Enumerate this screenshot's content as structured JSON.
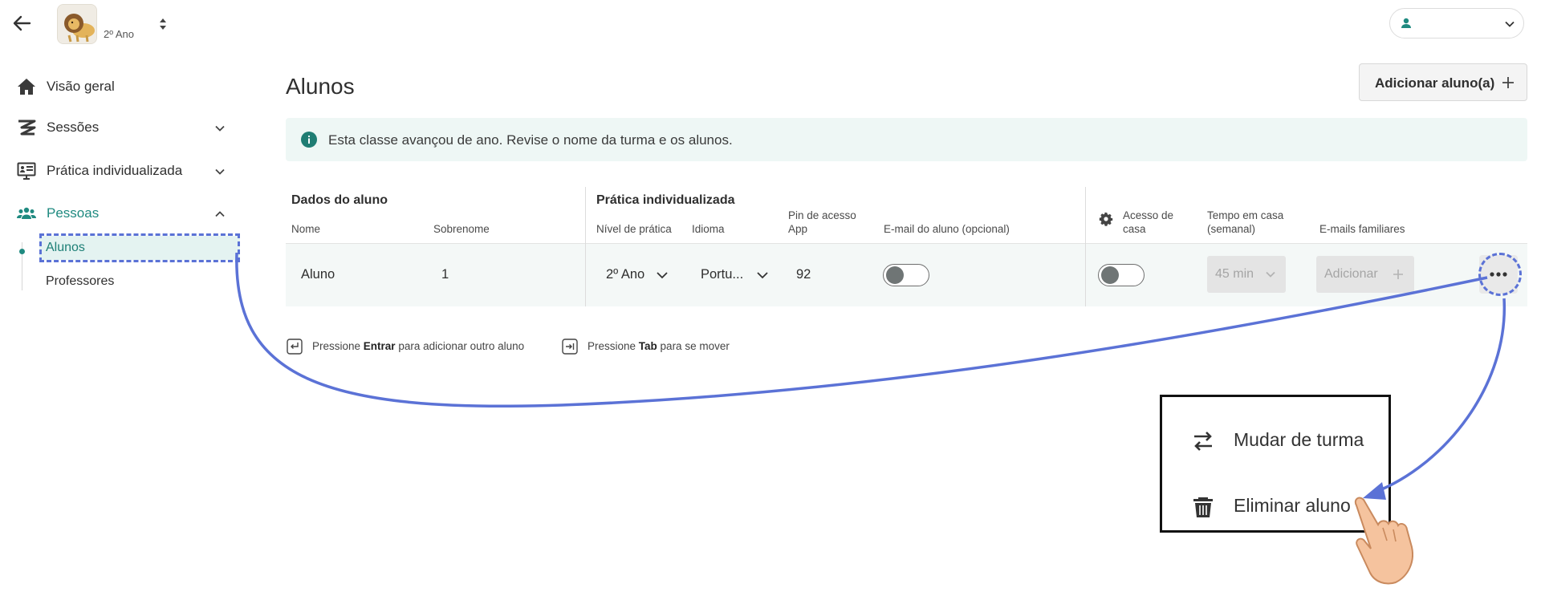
{
  "header": {
    "class_name": "2º Ano"
  },
  "sidebar": {
    "items": [
      {
        "label": "Visão geral",
        "icon": "home-icon"
      },
      {
        "label": "Sessões",
        "icon": "sessions-icon"
      },
      {
        "label": "Prática individualizada",
        "icon": "practice-icon"
      },
      {
        "label": "Pessoas",
        "icon": "people-icon"
      }
    ],
    "sub_items": [
      {
        "label": "Alunos",
        "active": true
      },
      {
        "label": "Professores",
        "active": false
      }
    ]
  },
  "main": {
    "title": "Alunos",
    "add_button_label": "Adicionar aluno(a)",
    "info_banner": "Esta classe avançou de ano. Revise o nome da turma e os alunos."
  },
  "table": {
    "group_student": "Dados do aluno",
    "group_practice": "Prática individualizada",
    "columns": {
      "nome": "Nome",
      "sobrenome": "Sobrenome",
      "nivel": "Nível de prática",
      "idioma": "Idioma",
      "pin_line1": "Pin de acesso",
      "pin_line2": "App",
      "email": "E-mail do aluno (opcional)",
      "acesso_line1": "Acesso de",
      "acesso_line2": "casa",
      "tempo_line1": "Tempo em casa",
      "tempo_line2": "(semanal)",
      "emails_familiares": "E-mails familiares"
    },
    "row": {
      "nome": "Aluno",
      "sobrenome": "1",
      "nivel": "2º Ano",
      "idioma": "Portu...",
      "pin": "92",
      "email_toggle_on": false,
      "acesso_toggle_on": false,
      "tempo": "45 min",
      "emails_add": "Adicionar"
    }
  },
  "hints": {
    "enter_pre": "Pressione ",
    "enter_key": "Entrar",
    "enter_post": " para adicionar outro aluno",
    "tab_pre": "Pressione ",
    "tab_key": "Tab",
    "tab_post": " para se mover"
  },
  "context_menu": {
    "items": [
      {
        "label": "Mudar de turma",
        "icon": "swap-icon"
      },
      {
        "label": "Eliminar aluno",
        "icon": "trash-icon"
      }
    ]
  },
  "colors": {
    "accent": "#1f8a80",
    "annotation": "#5b72d6",
    "info_banner_bg": "#eef7f5"
  }
}
